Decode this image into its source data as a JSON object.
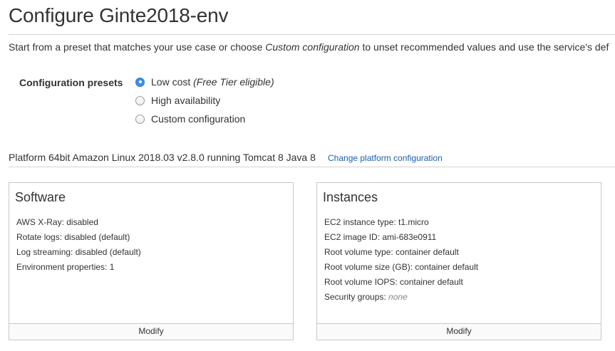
{
  "header": {
    "title": "Configure Ginte2018-env"
  },
  "intro": {
    "part1": "Start from a preset that matches your use case or choose ",
    "emphasis": "Custom configuration",
    "part2": " to unset recommended values and use the service's def"
  },
  "presets": {
    "label": "Configuration presets",
    "options": [
      {
        "label": "Low cost ",
        "note": "(Free Tier eligible)",
        "selected": true
      },
      {
        "label": "High availability",
        "note": "",
        "selected": false
      },
      {
        "label": "Custom configuration",
        "note": "",
        "selected": false
      }
    ]
  },
  "platform": {
    "text": "Platform 64bit Amazon Linux 2018.03 v2.8.0 running Tomcat 8 Java 8",
    "link": "Change platform configuration"
  },
  "software": {
    "title": "Software",
    "lines": [
      "AWS X-Ray: disabled",
      "Rotate logs: disabled (default)",
      "Log streaming: disabled (default)",
      "Environment properties: 1"
    ],
    "modify": "Modify"
  },
  "instances": {
    "title": "Instances",
    "lines": [
      "EC2 instance type: t1.micro",
      "EC2 image ID: ami-683e0911",
      "Root volume type: container default",
      "Root volume size (GB): container default",
      "Root volume IOPS: container default"
    ],
    "security_label": "Security groups: ",
    "security_value": "none",
    "modify": "Modify"
  },
  "colors": {
    "radio_selected": "#3b8ef0",
    "link": "#1c5fa8"
  }
}
